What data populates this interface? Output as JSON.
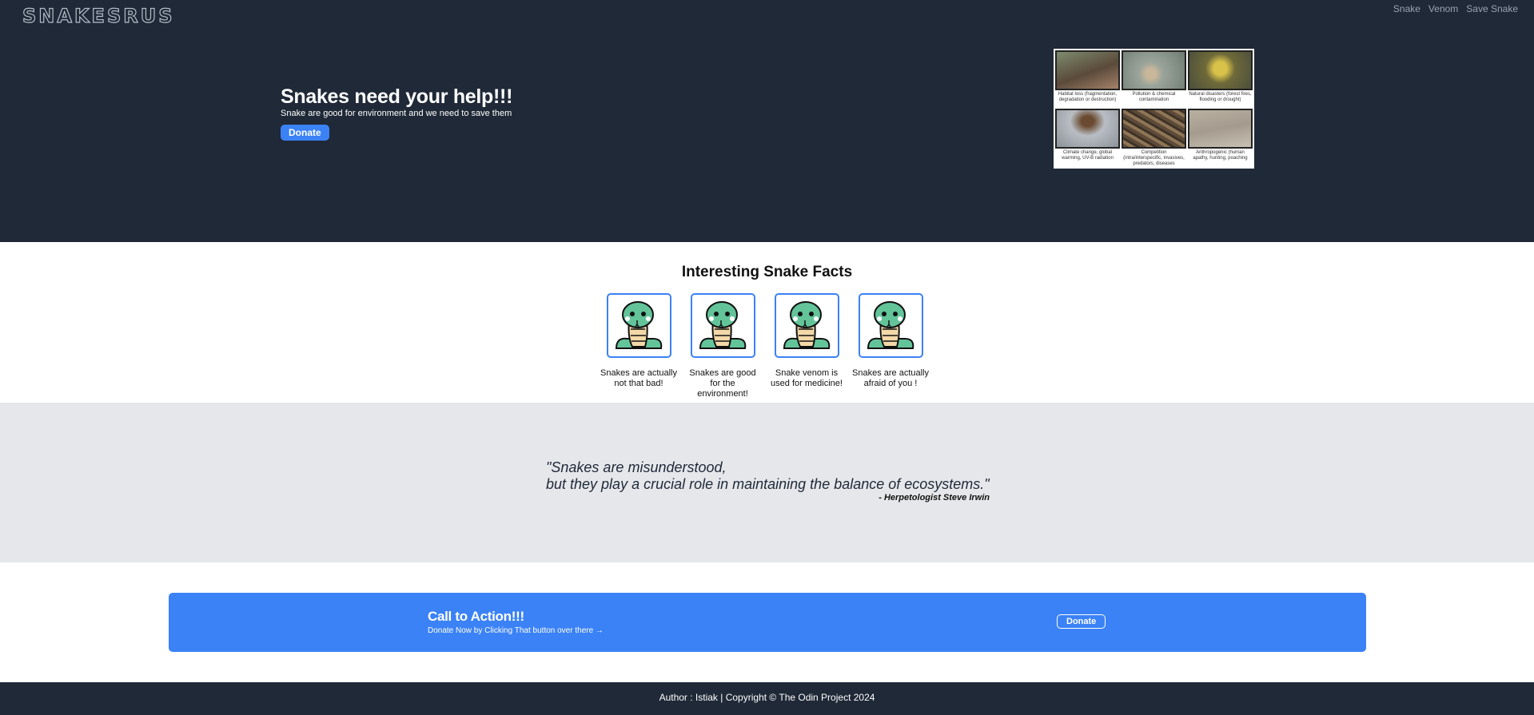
{
  "header": {
    "logo": "SNAKESRUS",
    "nav": [
      "Snake",
      "Venom",
      "Save Snake"
    ]
  },
  "hero": {
    "title": "Snakes need your help!!!",
    "subtitle": "Snake are good for environment and we need to save them",
    "donate_label": "Donate",
    "image_captions": [
      "Habitat loss (fragmentation, degradation or destruction)",
      "Pollution & chemical contamination",
      "Natural disasters (forest fires, flooding or drought)",
      "Climate change, global warming, UV-B radiation",
      "Competition (intra/interspecific, invasives, predators, diseases",
      "Anthropogenic (human apathy, hunting, poaching"
    ]
  },
  "facts": {
    "title": "Interesting Snake Facts",
    "cards": [
      "Snakes are actually not that bad!",
      "Snakes are good for the environment!",
      "Snake venom is used for medicine!",
      "Snakes are actually afraid of you !"
    ]
  },
  "quote": {
    "line1": "\"Snakes are misunderstood,",
    "line2": "but they play a crucial role in maintaining the balance of ecosystems.\"",
    "author": "- Herpetologist Steve Irwin"
  },
  "cta": {
    "title": "Call to Action!!!",
    "subtitle": "Donate Now by Clicking That button over there →",
    "button_label": "Donate"
  },
  "footer": {
    "text": "Author : Istiak | Copyright © The Odin Project 2024"
  },
  "colors": {
    "dark": "#1f2937",
    "accent": "#3b82f6",
    "quote_bg": "#e5e7eb"
  }
}
